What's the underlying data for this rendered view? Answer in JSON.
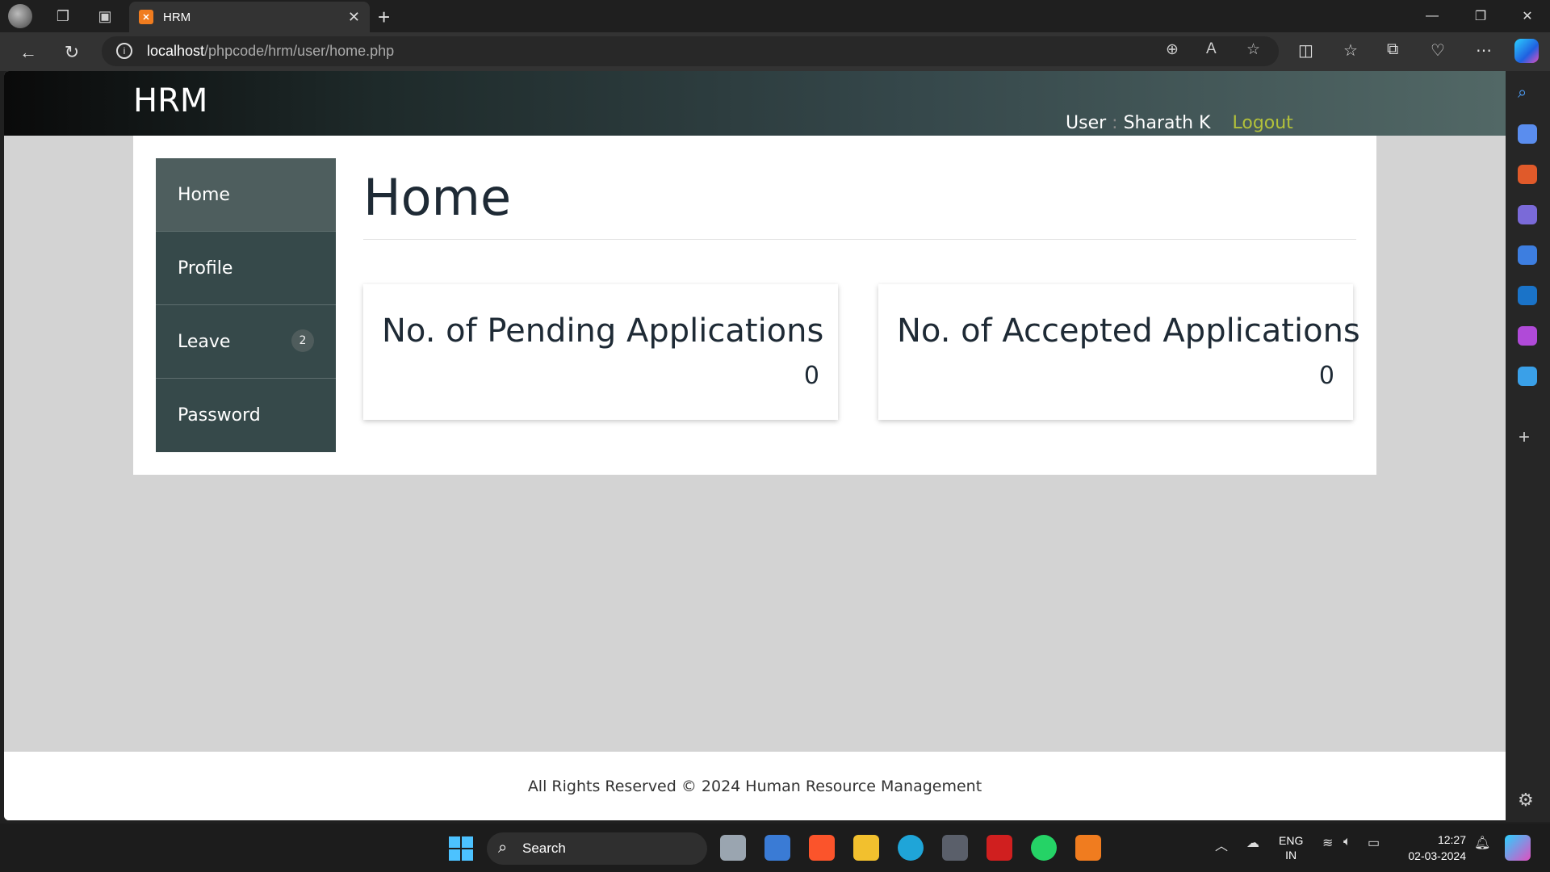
{
  "browser": {
    "tab_title": "HRM",
    "tab_favicon": "xampp-icon",
    "url_host": "localhost",
    "url_path": "/phpcode/hrm/user/home.php"
  },
  "site": {
    "brand": "HRM",
    "user_label": "User",
    "user_sep": ":",
    "user_name": "Sharath K",
    "logout": "Logout"
  },
  "menu": [
    {
      "label": "Home",
      "badge": ""
    },
    {
      "label": "Profile",
      "badge": ""
    },
    {
      "label": "Leave",
      "badge": "2"
    },
    {
      "label": "Password",
      "badge": ""
    }
  ],
  "page": {
    "title": "Home"
  },
  "cards": [
    {
      "title": "No. of Pending Applications",
      "value": "0"
    },
    {
      "title": "No. of Accepted Applications",
      "value": "0"
    }
  ],
  "footer": "All Rights Reserved © 2024 Human Resource Management",
  "taskbar": {
    "search_label": "Search",
    "lang_line1": "ENG",
    "lang_line2": "IN",
    "time": "12:27",
    "date": "02-03-2024"
  },
  "colors": {
    "menu_bg": "#36494a",
    "menu_active": "#4e5e5e",
    "logout": "#b3c13a",
    "page_bg": "#d3d3d3"
  }
}
